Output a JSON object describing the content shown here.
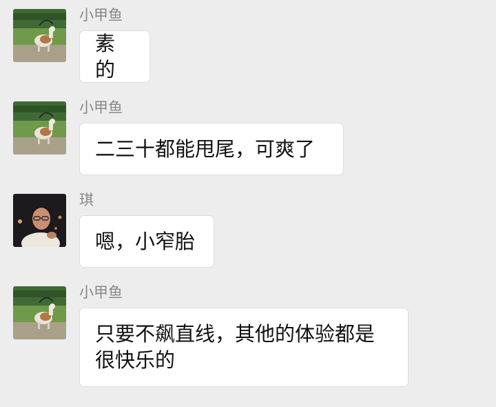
{
  "messages": [
    {
      "sender": "小甲鱼",
      "text": "素的",
      "avatar_icon": "oryx-avatar-icon"
    },
    {
      "sender": "小甲鱼",
      "text": "二三十都能甩尾，可爽了",
      "avatar_icon": "oryx-avatar-icon"
    },
    {
      "sender": "琪",
      "text": "嗯，小窄胎",
      "avatar_icon": "person-avatar-icon"
    },
    {
      "sender": "小甲鱼",
      "text": "只要不飙直线，其他的体验都是很快乐的",
      "avatar_icon": "oryx-avatar-icon"
    }
  ],
  "colors": {
    "background": "#ededed",
    "bubble": "#ffffff",
    "sender_text": "#888888",
    "message_text": "#111111"
  }
}
